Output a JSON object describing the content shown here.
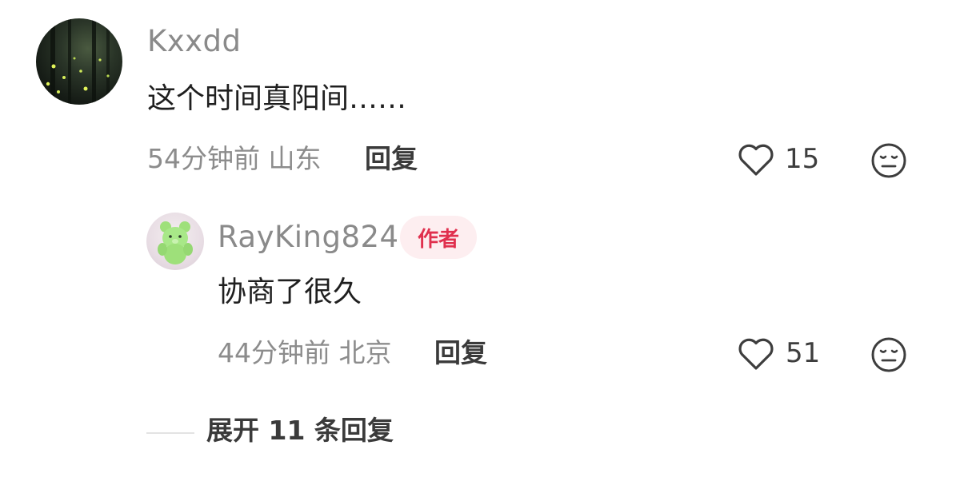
{
  "comment": {
    "username": "Kxxdd",
    "text": "这个时间真阳间……",
    "meta": "54分钟前 山东",
    "reply_label": "回复",
    "like_count": "15"
  },
  "reply": {
    "username": "RayKing824",
    "badge": "作者",
    "text": "协商了很久",
    "meta": "44分钟前 北京",
    "reply_label": "回复",
    "like_count": "51"
  },
  "expand": {
    "label": "展开 11 条回复"
  },
  "colors": {
    "badge_bg": "#fdeef0",
    "badge_text": "#e0304e",
    "meta_text": "#8c8c8c",
    "username_text": "#8a8a8a"
  },
  "icons": {
    "like": "heart-outline-icon",
    "dislike": "neutral-face-icon"
  }
}
